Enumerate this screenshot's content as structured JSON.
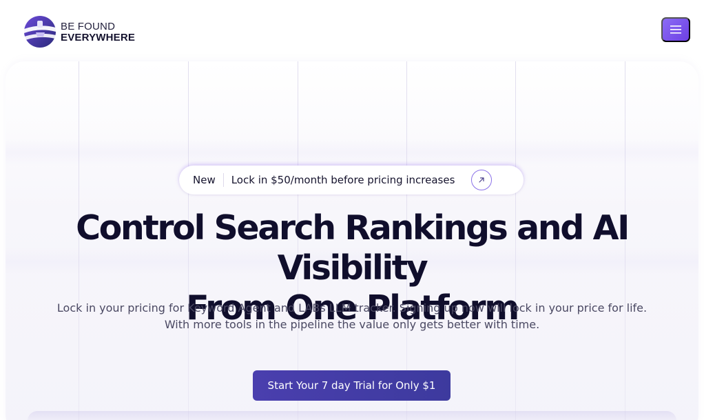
{
  "brand": {
    "line1": "BE FOUND",
    "line2": "EVERYWHERE",
    "colors": {
      "accent": "#7c5cf0",
      "cta": "#433ca6",
      "text": "#100e2c"
    }
  },
  "nav": {
    "menu_icon": "hamburger-icon"
  },
  "announcement": {
    "tag": "New",
    "text": "Lock in $50/month before pricing increases",
    "icon": "arrow-up-right-icon"
  },
  "hero": {
    "headline_line1": "Control Search Rankings and AI Visibility",
    "headline_line2": "From One Platform",
    "sub_line1": "Lock in your pricing for Keyword Agent and LABs LLM tracker. Signing up now will lock in your price for life.",
    "sub_line2": "With more tools in the pipeline the value only gets better with time.",
    "cta_label": "Start Your 7 day Trial for Only $1"
  }
}
